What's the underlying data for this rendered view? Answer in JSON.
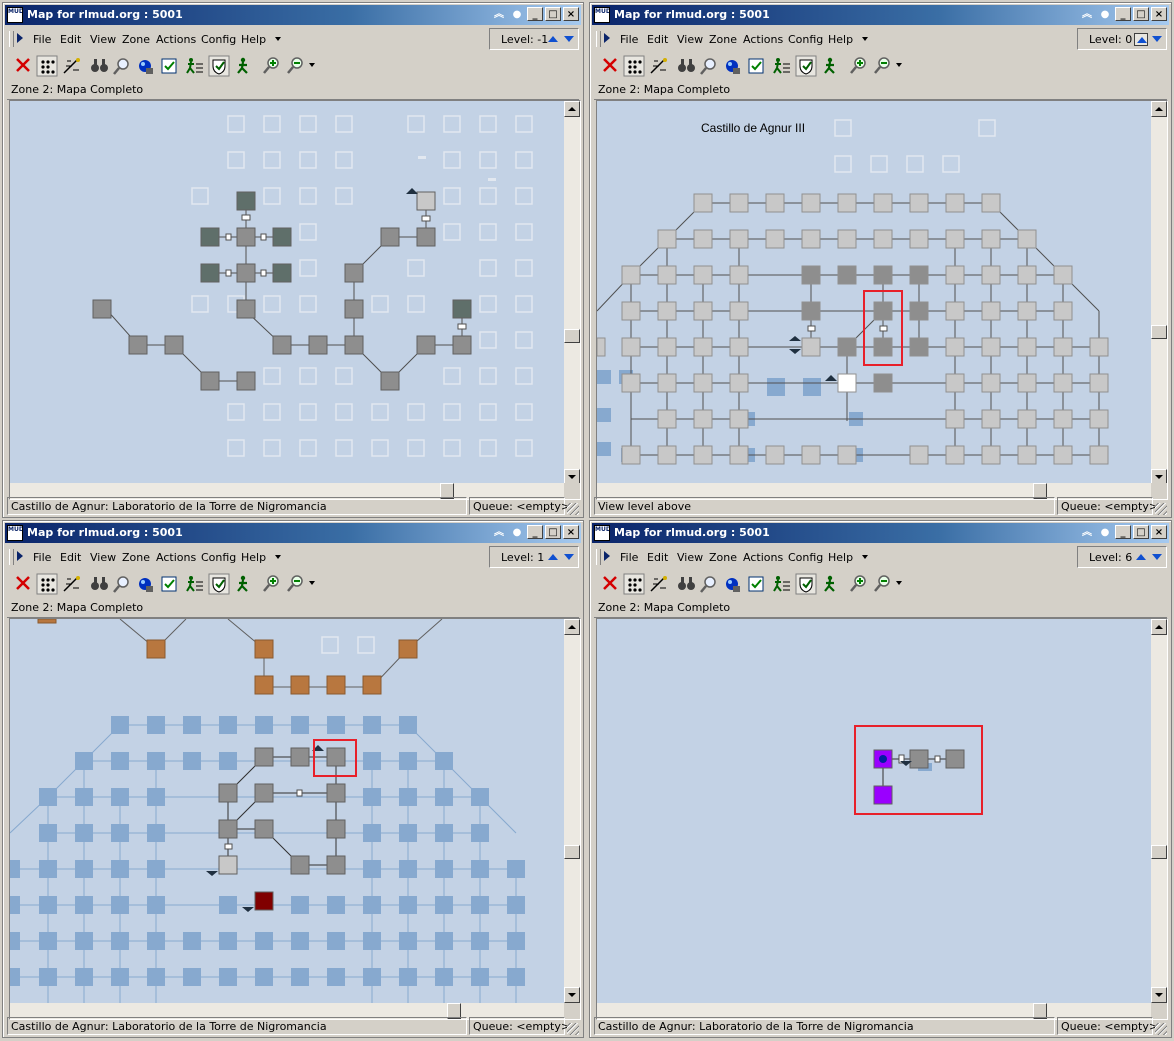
{
  "windows": [
    {
      "title": "Map for rlmud.org : 5001",
      "level": "Level: -1",
      "zone": "Zone 2: Mapa Completo",
      "status": "Castillo de Agnur: Laboratorio de la Torre de Nigromancia",
      "queue": "Queue: <empty>",
      "level_up_pressed": false
    },
    {
      "title": "Map for rlmud.org : 5001",
      "level": "Level: 0",
      "zone": "Zone 2: Mapa Completo",
      "status": "View level above",
      "queue": "Queue: <empty>",
      "level_up_pressed": true,
      "map_label": "Castillo de Agnur III"
    },
    {
      "title": "Map for rlmud.org : 5001",
      "level": "Level: 1",
      "zone": "Zone 2: Mapa Completo",
      "status": "Castillo de Agnur: Laboratorio de la Torre de Nigromancia",
      "queue": "Queue: <empty>",
      "level_up_pressed": false
    },
    {
      "title": "Map for rlmud.org : 5001",
      "level": "Level: 6",
      "zone": "Zone 2: Mapa Completo",
      "status": "Castillo de Agnur: Laboratorio de la Torre de Nigromancia",
      "queue": "Queue: <empty>",
      "level_up_pressed": false
    }
  ],
  "menu": [
    "File",
    "Edit",
    "View",
    "Zone",
    "Actions",
    "Config",
    "Help"
  ],
  "toolbar_icons": [
    "close-red-x-icon",
    "walk-grid-icon",
    "auto-path-icon",
    "binoculars-icon",
    "find-icon",
    "globe-icon",
    "check-icon",
    "speedwalk-icon",
    "mapper-shield-icon",
    "walker-icon",
    "zoom-in-icon",
    "zoom-out-icon"
  ],
  "title_icon_text": "MUD",
  "colors": {
    "map_background": "#c3d2e5",
    "room_gray": "#8e8e8e",
    "room_light": "#c8c8c8",
    "room_dark_green": "#5f6f6a",
    "room_orange": "#b8773f",
    "room_blue": "#87a9cf",
    "room_current": "#800000",
    "room_purple": "#9a00ff",
    "highlight_red": "#e8202a",
    "title_bar": "#0a246a"
  }
}
